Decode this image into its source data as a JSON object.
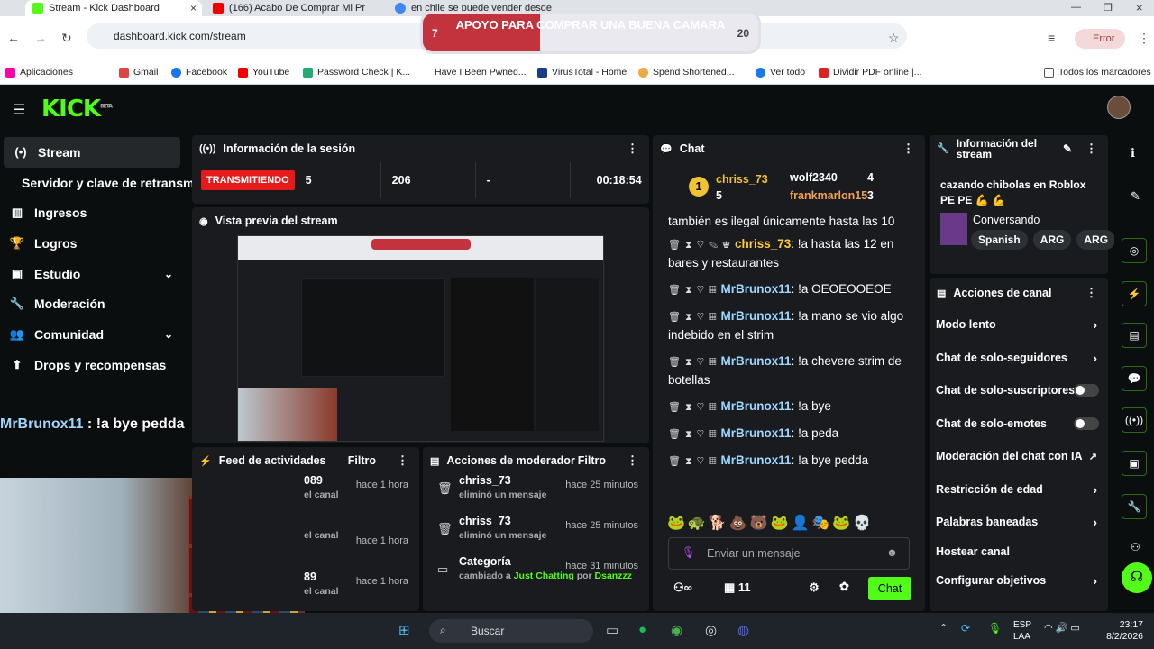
{
  "browser": {
    "tabs": [
      "Stream - Kick Dashboard",
      "(166) Acabo De Comprar Mi Pr",
      "en chile se puede vender desde"
    ],
    "url": "dashboard.kick.com/stream",
    "profile": "Error",
    "bookmarks": [
      "Aplicaciones",
      "Gmail",
      "Facebook",
      "YouTube",
      "Password Check | K...",
      "Have I Been Pwned...",
      "VirusTotal - Home",
      "Spend Shortened...",
      "Ver todo",
      "Dividir PDF online |...",
      "Todos los marcadores"
    ]
  },
  "goal": {
    "title": "APOYO PARA COMPRAR UNA BUENA CAMARA",
    "current": "7",
    "target": "20",
    "progress": 0.35
  },
  "logo": "KICK",
  "logo_sup": "BETA",
  "sidebar": [
    {
      "label": "Stream",
      "icon": "broadcast-icon"
    },
    {
      "label": "Servidor y clave de retransm",
      "icon": ""
    },
    {
      "label": "Ingresos",
      "icon": "chart-icon"
    },
    {
      "label": "Logros",
      "icon": "trophy-icon"
    },
    {
      "label": "Estudio",
      "icon": "studio-icon"
    },
    {
      "label": "Moderación",
      "icon": "wrench-icon"
    },
    {
      "label": "Comunidad",
      "icon": "people-icon"
    },
    {
      "label": "Drops y recompensas",
      "icon": "drops-icon"
    }
  ],
  "overlay": {
    "user": "MrBrunox11",
    "text": " : !a bye pedda"
  },
  "session": {
    "title": "Información de la sesión",
    "live": "TRANSMITIENDO",
    "viewers": "5",
    "followers": "206",
    "subs": "-",
    "time": "00:18:54"
  },
  "preview": {
    "title": "Vista previa del stream"
  },
  "feed": {
    "title": "Feed de actividades",
    "filter": "Filtro",
    "rows": [
      {
        "a": "089",
        "b": "el canal",
        "t": "hace 1 hora"
      },
      {
        "a": "",
        "b": "el canal",
        "t": "hace 1 hora"
      },
      {
        "a": "89",
        "b": "el canal",
        "t": "hace 1 hora"
      }
    ]
  },
  "mod": {
    "title": "Acciones de moderador",
    "filter": "Filtro",
    "rows": [
      {
        "user": "chriss_73",
        "action": "eliminó un mensaje",
        "time": "hace 25 minutos"
      },
      {
        "user": "chriss_73",
        "action": "eliminó un mensaje",
        "time": "hace 25 minutos"
      },
      {
        "user": "Categoría",
        "pre": "cambiado a ",
        "cat": "Just Chatting",
        "by": " por ",
        "who": "Dsanzzz",
        "time": "hace 31 minutos"
      }
    ]
  },
  "chat": {
    "title": "Chat",
    "leaders": [
      {
        "name": "chriss_73",
        "n": "5"
      },
      {
        "name": "wolf2340",
        "n": "4"
      },
      {
        "name": "frankmarlon15",
        "n": "3"
      }
    ],
    "messages": [
      {
        "user": "",
        "text": "también es ilegal únicamente hasta las 10",
        "cls": "u1"
      },
      {
        "user": "chriss_73",
        "text": ": !a hasta las 12 en bares y restaurantes",
        "cls": "u2"
      },
      {
        "user": "MrBrunox11",
        "text": ": !a OEOEOOEOE",
        "cls": "u3"
      },
      {
        "user": "MrBrunox11",
        "text": ": !a mano se vio algo indebido en el strim",
        "cls": "u3"
      },
      {
        "user": "MrBrunox11",
        "text": ": !a chevere strim de botellas",
        "cls": "u3"
      },
      {
        "user": "MrBrunox11",
        "text": ": !a bye",
        "cls": "u3"
      },
      {
        "user": "MrBrunox11",
        "text": ": !a peda",
        "cls": "u3"
      },
      {
        "user": "MrBrunox11",
        "text": ": !a bye pedda",
        "cls": "u3"
      }
    ],
    "placeholder": "Enviar un mensaje",
    "count": "11",
    "send": "Chat"
  },
  "info": {
    "title": "Información del stream",
    "stream_title": "cazando chibolas en Roblox PE PE 💪 💪",
    "category": "Conversando",
    "tags": [
      "Spanish",
      "ARG",
      "ARG"
    ]
  },
  "actions": {
    "title": "Acciones de canal",
    "items": [
      "Modo lento",
      "Chat de solo-seguidores",
      "Chat de solo-suscriptores",
      "Chat de solo-emotes",
      "Moderación del chat con IA",
      "Restricción de edad",
      "Palabras baneadas",
      "Hostear canal",
      "Configurar objetivos"
    ]
  },
  "taskbar": {
    "search": "Buscar",
    "lang1": "ESP",
    "lang2": "LAA",
    "time": "23:17",
    "date": "8/2/2026"
  }
}
